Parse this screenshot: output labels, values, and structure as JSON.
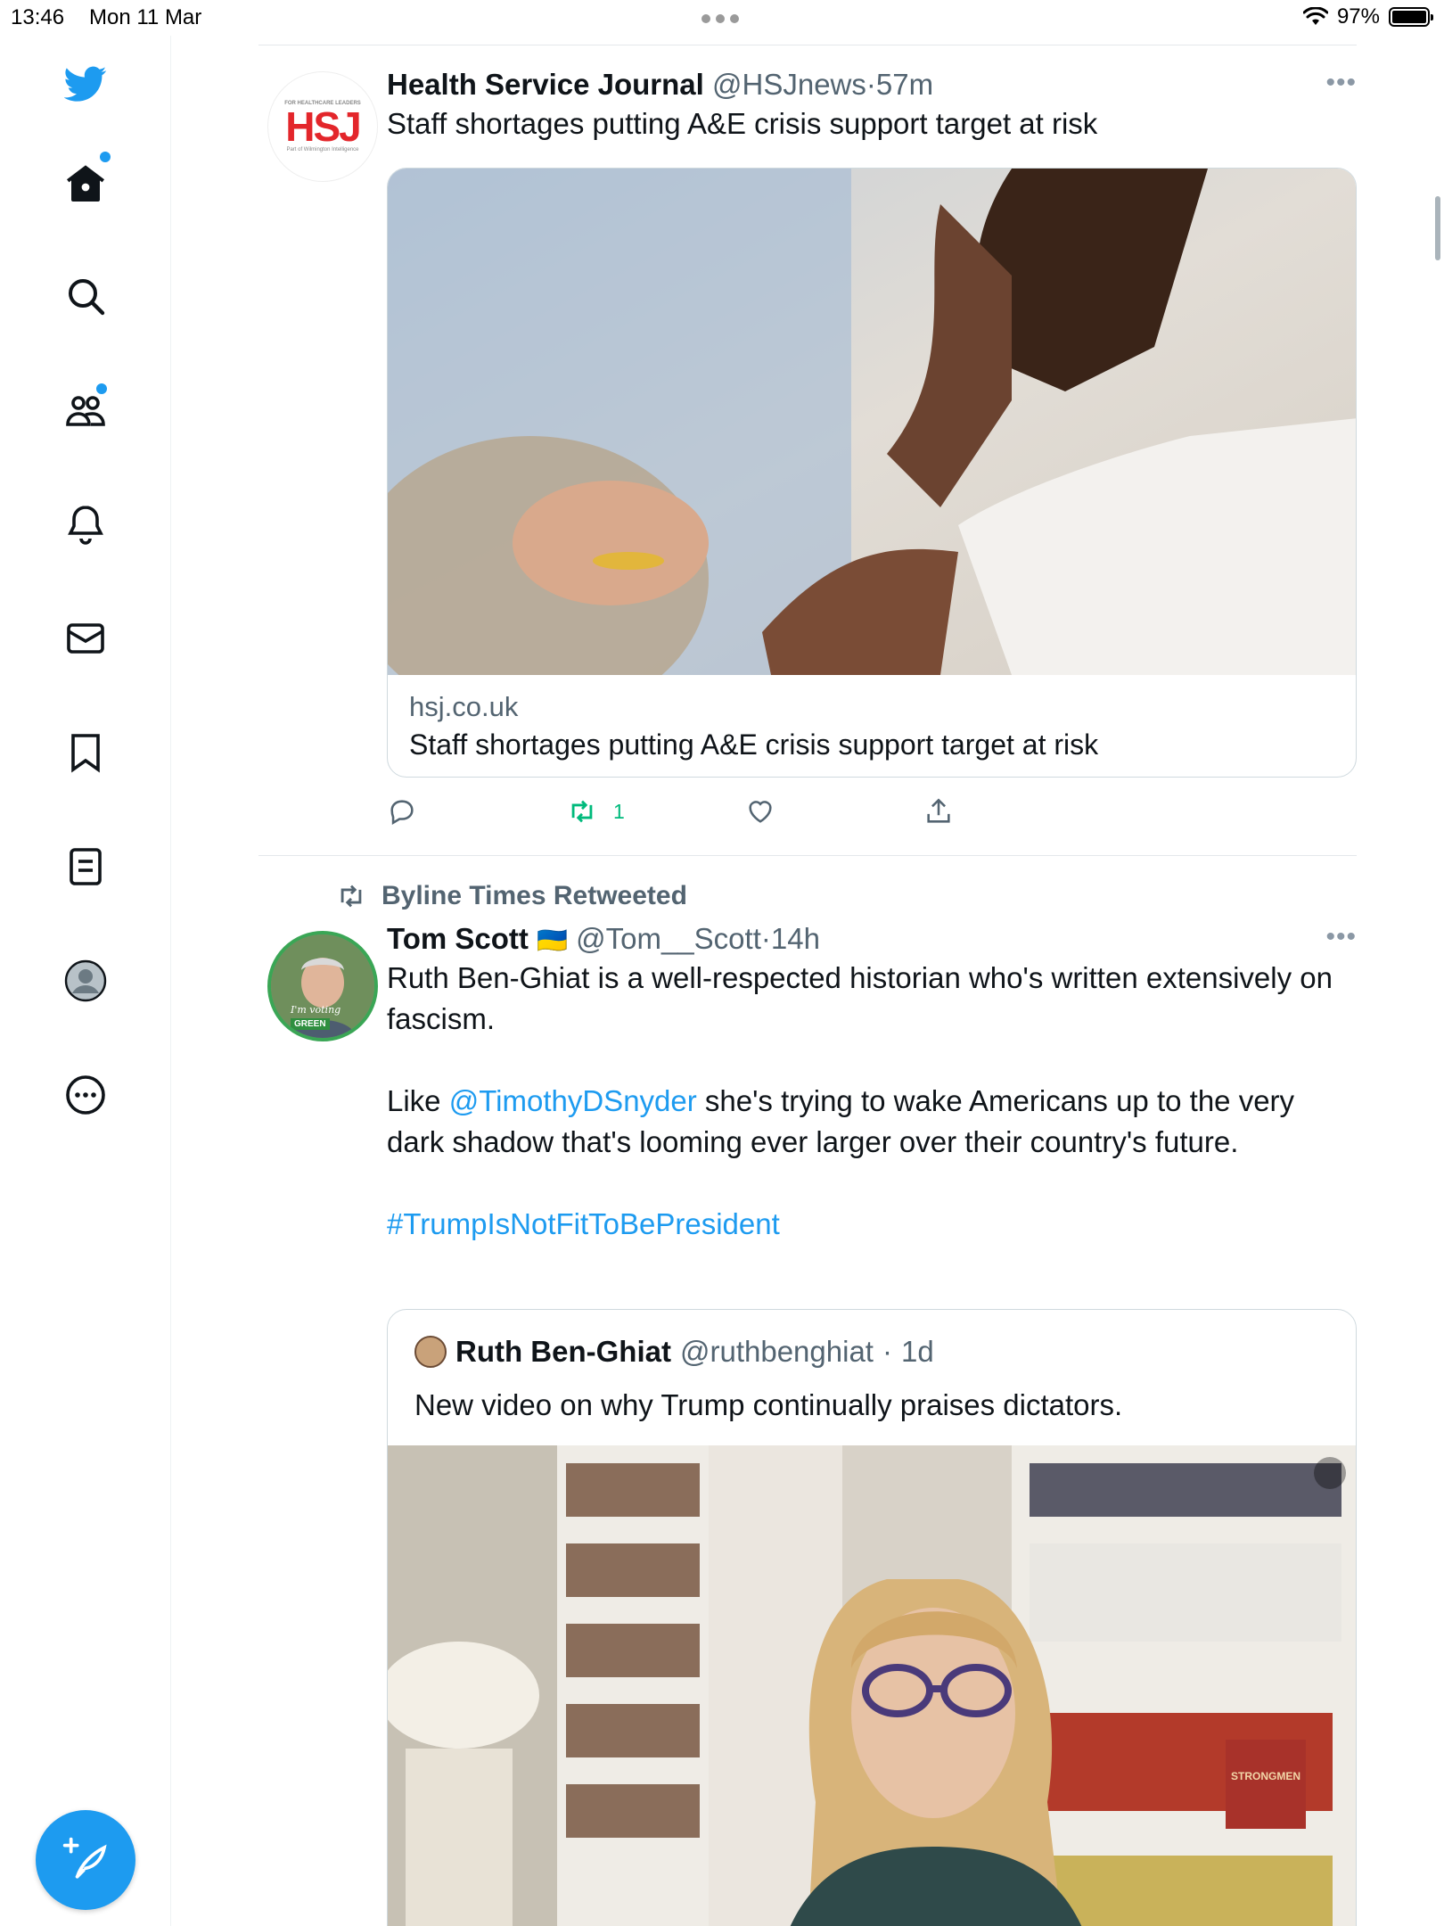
{
  "status_bar": {
    "time": "13:46",
    "date": "Mon 11 Mar",
    "battery": "97%"
  },
  "sidebar": {
    "items": [
      {
        "name": "twitter-logo",
        "label": ""
      },
      {
        "name": "home",
        "label": ""
      },
      {
        "name": "search",
        "label": ""
      },
      {
        "name": "communities",
        "label": ""
      },
      {
        "name": "notifications",
        "label": ""
      },
      {
        "name": "messages",
        "label": ""
      },
      {
        "name": "bookmarks",
        "label": ""
      },
      {
        "name": "lists",
        "label": ""
      },
      {
        "name": "profile",
        "label": ""
      },
      {
        "name": "more",
        "label": ""
      }
    ],
    "compose_icon": "feather-plus-icon"
  },
  "tweet1": {
    "display_name": "Health Service Journal",
    "handle": "@HSJnews",
    "separator": "·",
    "time": "57m",
    "text": "Staff shortages putting A&E crisis support target at risk",
    "avatar": {
      "top_text": "FOR HEALTHCARE LEADERS",
      "logo": "HSJ",
      "bottom_text": "Part of Wilmington Intelligence"
    },
    "card": {
      "domain": "hsj.co.uk",
      "title": "Staff shortages putting A&E crisis support target at risk"
    },
    "stats": {
      "retweets": "1"
    },
    "colors": {
      "retweet_active": "#00ba7c",
      "logo_red": "#e3262b"
    }
  },
  "tweet2": {
    "social_context": "Byline Times Retweeted",
    "display_name": "Tom Scott",
    "flag": "🇺🇦",
    "handle": "@Tom__Scott",
    "separator": "·",
    "time": "14h",
    "avatar_badge": {
      "line1": "I'm voting",
      "line2": "GREEN"
    },
    "text_p1": "Ruth Ben-Ghiat is a well-respected historian who's written extensively on fascism.",
    "text_p2_before": "Like ",
    "text_p2_mention": "@TimothyDSnyder",
    "text_p2_after": " she's trying to wake Americans up to the very dark shadow that's looming ever larger over their country's future.",
    "hashtag": "#TrumpIsNotFitToBePresident",
    "quote": {
      "display_name": "Ruth Ben-Ghiat",
      "handle": "@ruthbenghiat",
      "separator": "·",
      "time": "1d",
      "text": "New video on why Trump continually praises dictators.",
      "book_spine": "STRONGMEN"
    }
  },
  "colors": {
    "accent": "#1d9bf0",
    "text": "#0f1419",
    "secondary": "#536471"
  }
}
